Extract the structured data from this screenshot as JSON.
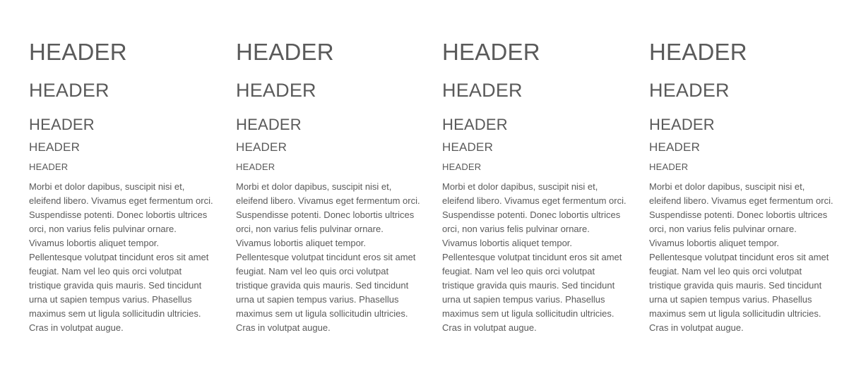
{
  "columns": [
    {
      "h1": "HEADER",
      "h2": "HEADER",
      "h3": "HEADER",
      "h4": "HEADER",
      "h5": "HEADER",
      "paragraph": "Morbi et dolor dapibus, suscipit nisi et, eleifend libero. Vivamus eget fermentum orci. Suspendisse potenti. Donec lobortis ultrices orci, non varius felis pulvinar ornare. Vivamus lobortis aliquet tempor. Pellentesque volutpat tincidunt eros sit amet feugiat. Nam vel leo quis orci volutpat tristique gravida quis mauris. Sed tincidunt urna ut sapien tempus varius. Phasellus maximus sem ut ligula sollicitudin ultricies. Cras in volutpat augue."
    },
    {
      "h1": "HEADER",
      "h2": "HEADER",
      "h3": "HEADER",
      "h4": "HEADER",
      "h5": "HEADER",
      "paragraph": "Morbi et dolor dapibus, suscipit nisi et, eleifend libero. Vivamus eget fermentum orci. Suspendisse potenti. Donec lobortis ultrices orci, non varius felis pulvinar ornare. Vivamus lobortis aliquet tempor. Pellentesque volutpat tincidunt eros sit amet feugiat. Nam vel leo quis orci volutpat tristique gravida quis mauris. Sed tincidunt urna ut sapien tempus varius. Phasellus maximus sem ut ligula sollicitudin ultricies. Cras in volutpat augue."
    },
    {
      "h1": "HEADER",
      "h2": "HEADER",
      "h3": "HEADER",
      "h4": "HEADER",
      "h5": "HEADER",
      "paragraph": "Morbi et dolor dapibus, suscipit nisi et, eleifend libero. Vivamus eget fermentum orci. Suspendisse potenti. Donec lobortis ultrices orci, non varius felis pulvinar ornare. Vivamus lobortis aliquet tempor. Pellentesque volutpat tincidunt eros sit amet feugiat. Nam vel leo quis orci volutpat tristique gravida quis mauris. Sed tincidunt urna ut sapien tempus varius. Phasellus maximus sem ut ligula sollicitudin ultricies. Cras in volutpat augue."
    },
    {
      "h1": "HEADER",
      "h2": "HEADER",
      "h3": "HEADER",
      "h4": "HEADER",
      "h5": "HEADER",
      "paragraph": "Morbi et dolor dapibus, suscipit nisi et, eleifend libero. Vivamus eget fermentum orci. Suspendisse potenti. Donec lobortis ultrices orci, non varius felis pulvinar ornare. Vivamus lobortis aliquet tempor. Pellentesque volutpat tincidunt eros sit amet feugiat. Nam vel leo quis orci volutpat tristique gravida quis mauris. Sed tincidunt urna ut sapien tempus varius. Phasellus maximus sem ut ligula sollicitudin ultricies. Cras in volutpat augue."
    }
  ]
}
